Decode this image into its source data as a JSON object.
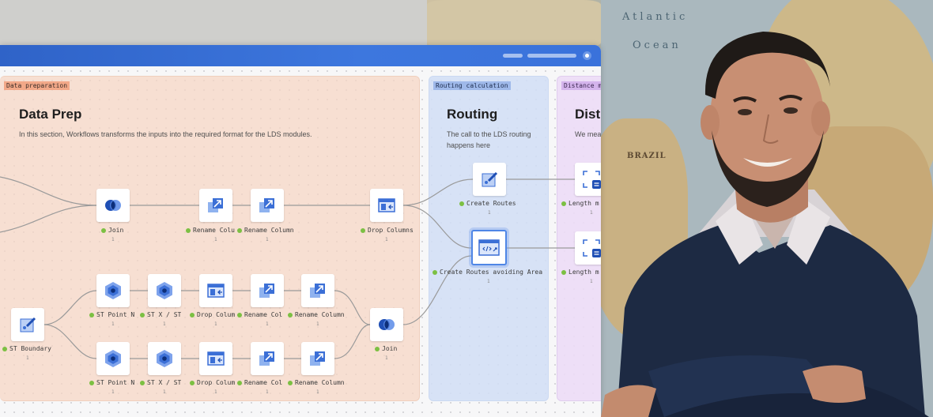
{
  "background": {
    "map_labels": [
      "Atlantic",
      "Ocean",
      "BRAZIL"
    ]
  },
  "app": {
    "colors": {
      "titlebar": "#3a72db",
      "prep_group": "#f7d6c4",
      "routing_group": "#d1def6",
      "distance_group": "#ecdcf6",
      "status_ok": "#7cc043"
    },
    "groups": {
      "prep": {
        "tag": "Data preparation",
        "title": "Data Prep",
        "description": "In this section, Workflows transforms the inputs into the required format for the LDS modules."
      },
      "routing": {
        "tag": "Routing calculation",
        "title": "Routing",
        "description": "The call to the LDS routing happens here"
      },
      "distance": {
        "tag": "Distance m",
        "title": "Dist",
        "description": "We mea the two"
      }
    },
    "nodes": {
      "join_top": {
        "label": "Join",
        "count": "1",
        "icon": "join-icon"
      },
      "rename_col_1": {
        "label": "Rename Colu",
        "count": "1",
        "icon": "rename-column-icon"
      },
      "rename_col_2": {
        "label": "Rename Column",
        "count": "1",
        "icon": "rename-column-icon"
      },
      "drop_columns": {
        "label": "Drop Columns",
        "count": "1",
        "icon": "drop-columns-icon"
      },
      "create_routes": {
        "label": "Create Routes",
        "count": "1",
        "icon": "create-routes-icon"
      },
      "create_routes_area": {
        "label": "Create Routes avoiding Area",
        "count": "1",
        "icon": "create-routes-area-icon"
      },
      "length_1": {
        "label": "Length m",
        "count": "1",
        "icon": "length-icon"
      },
      "length_2": {
        "label": "Length m",
        "count": "1",
        "icon": "length-icon"
      },
      "st_boundary": {
        "label": "ST Boundary",
        "count": "1",
        "icon": "st-boundary-icon"
      },
      "st_point_a": {
        "label": "ST Point N",
        "count": "1",
        "icon": "st-point-icon"
      },
      "st_x_a": {
        "label": "ST X / ST",
        "count": "1",
        "icon": "st-point-icon"
      },
      "drop_col_a": {
        "label": "Drop Colum",
        "count": "1",
        "icon": "drop-columns-icon"
      },
      "rename_a1": {
        "label": "Rename Col",
        "count": "1",
        "icon": "rename-column-icon"
      },
      "rename_a2": {
        "label": "Rename Column",
        "count": "1",
        "icon": "rename-column-icon"
      },
      "join_bottom": {
        "label": "Join",
        "count": "1",
        "icon": "join-icon"
      },
      "st_point_b": {
        "label": "ST Point N",
        "count": "1",
        "icon": "st-point-icon"
      },
      "st_x_b": {
        "label": "ST X / ST",
        "count": "1",
        "icon": "st-point-icon"
      },
      "drop_col_b": {
        "label": "Drop Colum",
        "count": "1",
        "icon": "drop-columns-icon"
      },
      "rename_b1": {
        "label": "Rename Col",
        "count": "1",
        "icon": "rename-column-icon"
      },
      "rename_b2": {
        "label": "Rename Column",
        "count": "1",
        "icon": "rename-column-icon"
      }
    }
  }
}
